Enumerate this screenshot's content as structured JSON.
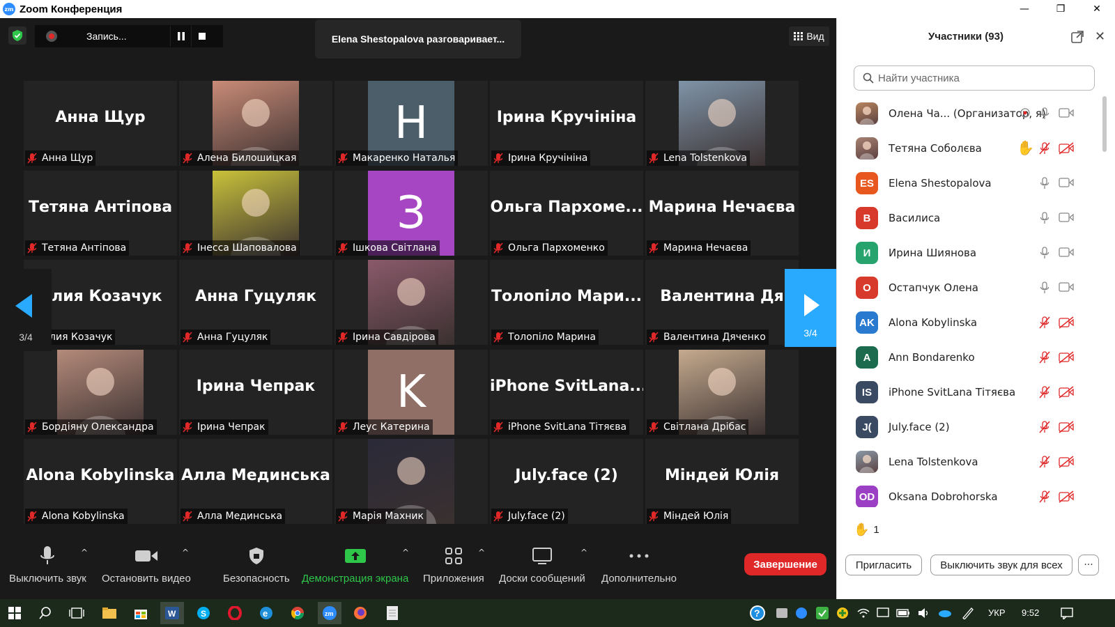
{
  "app": {
    "title": "Zoom Конференция",
    "logo": "zm"
  },
  "window_controls": {
    "minimize": "—",
    "maximize": "❐",
    "close": "✕"
  },
  "top": {
    "recording_label": "Запись...",
    "speaker_text": "Elena Shestopalova разговаривает...",
    "view_label": "Вид"
  },
  "gallery": {
    "page_indicator": "3/4",
    "tiles": [
      {
        "big": "Анна Щур",
        "label": "Анна Щур"
      },
      {
        "photo_color": "#c98b77",
        "label": "Алена Билошицкая"
      },
      {
        "letter": "H",
        "letter_bg": "#4d5e6b",
        "label": "Макаренко Наталья"
      },
      {
        "big": "Ірина Кручініна",
        "label": "Ірина Кручініна"
      },
      {
        "photo_color": "#7f94a8",
        "label": "Lena Tolstenkova"
      },
      {
        "big": "Тетяна Антіпова",
        "label": "Тетяна Антіпова"
      },
      {
        "photo_color": "#c9c23a",
        "label": "Інесса Шаповалова"
      },
      {
        "letter": "З",
        "letter_bg": "#a646c2",
        "label": "Ішкова Світлана"
      },
      {
        "big": "Ольга Пархоме...",
        "label": "Ольга Пархоменко"
      },
      {
        "big": "Марина Нечаєва",
        "label": "Марина Нечаєва"
      },
      {
        "big": "Олия Козачук",
        "label": "Олия Козачук"
      },
      {
        "big": "Анна Гуцуляк",
        "label": "Анна Гуцуляк"
      },
      {
        "photo_color": "#8a5a6a",
        "label": "Ірина Савдірова"
      },
      {
        "big": "Толопіло Мари...",
        "label": "Толопіло Марина"
      },
      {
        "big": "Валентина Дя",
        "label": "Валентина Дяченко"
      },
      {
        "photo_color": "#b48a7a",
        "label": "Бордіяну Олександра"
      },
      {
        "big": "Ірина Чепрак",
        "label": "Ірина Чепрак"
      },
      {
        "letter": "K",
        "letter_bg": "#8f6f66",
        "label": "Леус Катерина"
      },
      {
        "big": "iPhone SvitLana...",
        "label": "iPhone SvitLana Тітяєва"
      },
      {
        "photo_color": "#c5aa8e",
        "label": "Світлана Дрібас"
      },
      {
        "big": "Alona Kobylinska",
        "label": "Alona Kobylinska"
      },
      {
        "big": "Алла Мединська",
        "label": "Алла Мединська"
      },
      {
        "photo_color": "#2a2a38",
        "label": "Марія Махник"
      },
      {
        "big": "July.face (2)",
        "label": "July.face (2)"
      },
      {
        "big": "Міндей Юлія",
        "label": "Міндей Юлія"
      }
    ]
  },
  "toolbar": {
    "mute": "Выключить звук",
    "video": "Остановить видео",
    "security": "Безопасность",
    "share": "Демонстрация экрана",
    "apps": "Приложения",
    "whiteboards": "Доски сообщений",
    "more": "Дополнительно",
    "end": "Завершение"
  },
  "participants": {
    "title": "Участники (93)",
    "search_placeholder": "Найти участника",
    "rows": [
      {
        "name": "Олена Ча...   (Организатор, я)",
        "avatar_text": "",
        "avatar_color": "#b98660",
        "photo": true,
        "hand": false,
        "muted": false,
        "record": true
      },
      {
        "name": "Тетяна Соболєва",
        "avatar_text": "",
        "avatar_color": "#a88272",
        "photo": true,
        "hand": true,
        "muted": true
      },
      {
        "name": "Elena Shestopalova",
        "avatar_text": "ES",
        "avatar_color": "#e8581e",
        "muted": false
      },
      {
        "name": "Василиса",
        "avatar_text": "В",
        "avatar_color": "#d7392a",
        "muted": false
      },
      {
        "name": "Ирина Шиянова",
        "avatar_text": "И",
        "avatar_color": "#27a36e",
        "muted": false
      },
      {
        "name": "Остапчук Олена",
        "avatar_text": "О",
        "avatar_color": "#d7392a",
        "muted": false
      },
      {
        "name": "Alona Kobylinska",
        "avatar_text": "AK",
        "avatar_color": "#2a7ad0",
        "muted": true
      },
      {
        "name": "Ann Bondarenko",
        "avatar_text": "A",
        "avatar_color": "#1c6b4e",
        "muted": true
      },
      {
        "name": "iPhone SvitLana Тітяєва",
        "avatar_text": "IS",
        "avatar_color": "#3a4a63",
        "muted": true
      },
      {
        "name": "July.face (2)",
        "avatar_text": "J(",
        "avatar_color": "#3a4a63",
        "muted": true
      },
      {
        "name": "Lena Tolstenkova",
        "avatar_text": "",
        "avatar_color": "#8a9aa8",
        "photo": true,
        "muted": true
      },
      {
        "name": "Oksana Dobrohorska",
        "avatar_text": "OD",
        "avatar_color": "#9b3fc4",
        "muted": true
      }
    ],
    "raised_hands_count": "1",
    "invite": "Пригласить",
    "mute_all": "Выключить звук для всех",
    "more": "···"
  },
  "taskbar": {
    "language": "УКР",
    "time": "9:52"
  }
}
